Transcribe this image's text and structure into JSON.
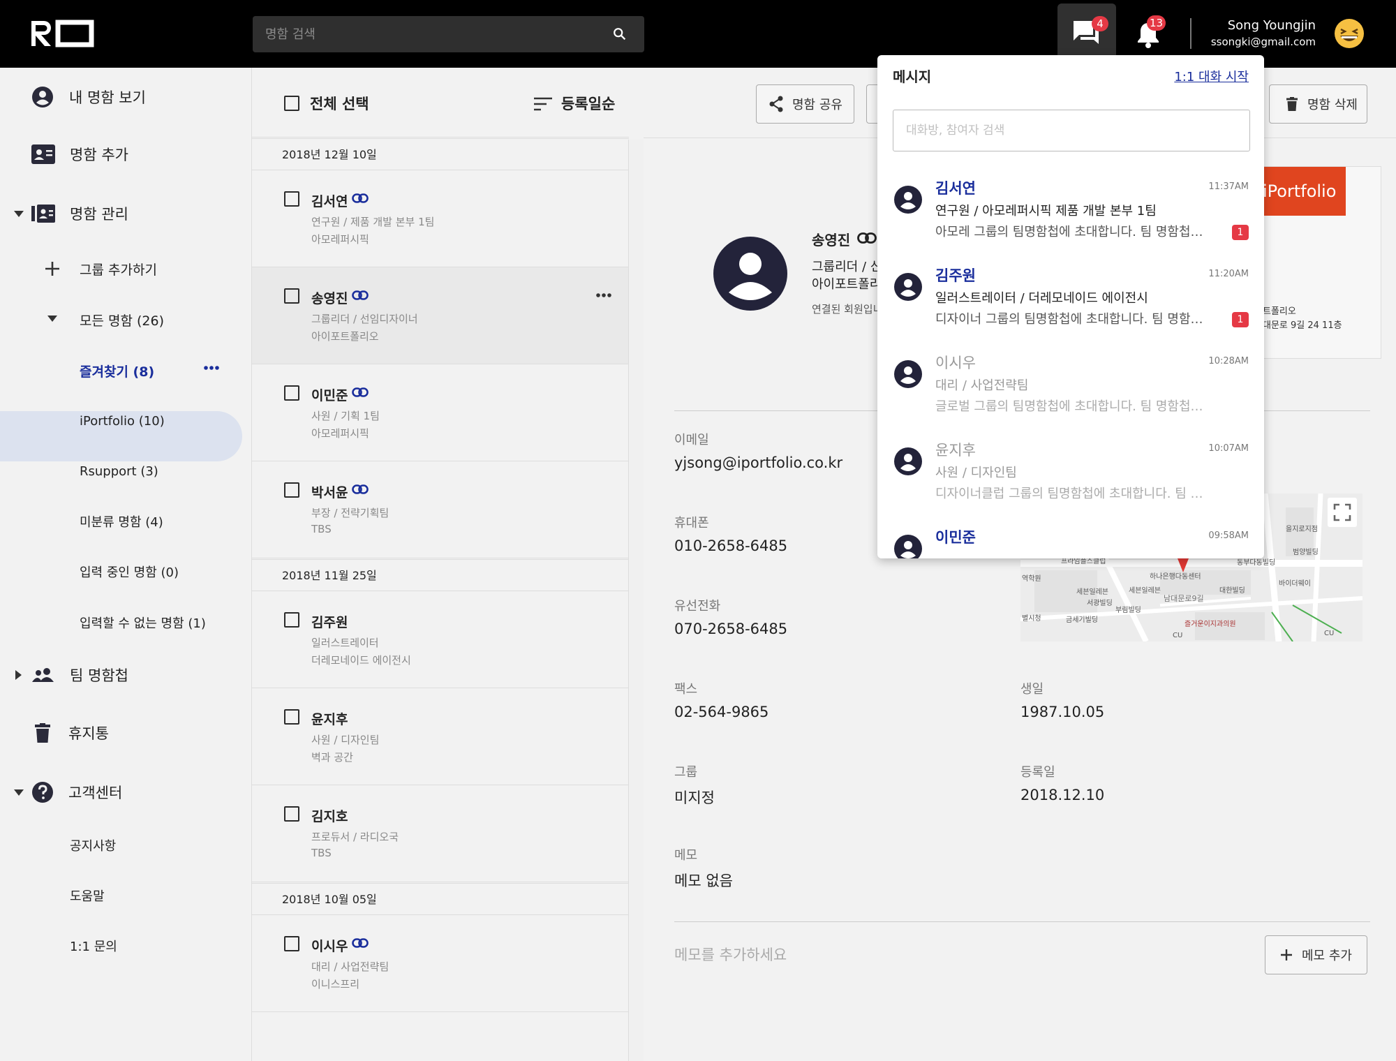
{
  "header": {
    "logo_text": "RO",
    "search_placeholder": "명함 검색",
    "messages_badge": "4",
    "notifications_badge": "13",
    "user_name": "Song Youngjin",
    "user_email": "ssongki@gmail.com"
  },
  "sidebar": {
    "my_card": "내 명함 보기",
    "add_card": "명함 추가",
    "manage": "명함 관리",
    "add_group": "그룹 추가하기",
    "all_cards": "모든 명함 (26)",
    "favorites": "즐겨찾기 (8)",
    "groups": [
      "iPortfolio (10)",
      "Rsupport (3)",
      "미분류 명함 (4)",
      "입력 중인 명함 (0)",
      "입력할 수 없는 명함 (1)"
    ],
    "team": "팀 명함첩",
    "trash": "휴지통",
    "support": "고객센터",
    "support_items": [
      "공지사항",
      "도움말",
      "1:1 문의"
    ]
  },
  "list": {
    "select_all": "전체 선택",
    "sort": "등록일순",
    "dates": [
      "2018년 12월 10일",
      "2018년 11월 25일",
      "2018년 10월 05일"
    ],
    "cards": [
      {
        "name": "김서연",
        "line1": "연구원 / 제품 개발 본부  1팀",
        "line2": "아모레퍼시픽"
      },
      {
        "name": "송영진",
        "line1": "그룹리더 / 선임디자이너",
        "line2": "아이포트폴리오"
      },
      {
        "name": "이민준",
        "line1": "사원 / 기획 1팀",
        "line2": "아모레퍼시픽"
      },
      {
        "name": "박서윤",
        "line1": "부장 / 전략기획팀",
        "line2": "TBS"
      },
      {
        "name": "김주원",
        "line1": "일러스트레이터",
        "line2": "더레모네이드 에이전시"
      },
      {
        "name": "윤지후",
        "line1": "사원 / 디자인팀",
        "line2": "벽과 공간"
      },
      {
        "name": "김지호",
        "line1": "프로듀서 / 라디오국",
        "line2": "TBS"
      },
      {
        "name": "이시우",
        "line1": "대리 / 사업전략팀",
        "line2": "이니스프리"
      }
    ]
  },
  "detail": {
    "share": "명함 공유",
    "delete": "명함 삭제",
    "name": "송영진",
    "role_partial": "그룹리더 / 신",
    "company_partial": "아이포트폴리",
    "connected_partial": "연결된 회원입니",
    "card_brand": "iPortfolio",
    "card_text1": "트폴리오",
    "card_text2": "대문로 9길 24 11층",
    "email_label": "이메일",
    "email": "yjsong@iportfolio.co.kr",
    "mobile_label": "휴대폰",
    "mobile": "010-2658-6485",
    "phone_label": "유선전화",
    "phone": "070-2658-6485",
    "fax_label": "팩스",
    "fax": "02-564-9865",
    "birthday_label": "생일",
    "birthday": "1987.10.05",
    "group_label": "그룹",
    "group": "미지정",
    "registered_label": "등록일",
    "registered": "2018.12.10",
    "memo_label": "메모",
    "memo": "메모 없음",
    "memo_placeholder": "메모를 추가하세요",
    "add_memo": "메모 추가"
  },
  "map_labels": [
    "프라임플스클럽",
    "하나은행다동센터",
    "동부다동빌딩",
    "역학원",
    "세븐일레븐",
    "세븐일레븐",
    "대한빌딩",
    "서광빌딩",
    "부림빌딩",
    "남대문로9길",
    "별시청",
    "금세기빌딩",
    "즐거운이지과의원",
    "을지로지점",
    "범양빌딩",
    "바이더웨이",
    "CU",
    "CU"
  ],
  "messages": {
    "title": "메시지",
    "start_chat": "1:1 대화 시작",
    "search_placeholder": "대화방, 참여자 검색",
    "items": [
      {
        "name": "김서연",
        "time": "11:37AM",
        "line1": "연구원 / 아모레퍼시픽 제품 개발 본부 1팀",
        "line2": "아모레 그룹의 팀명함첩에 초대합니다. 팀 명함첩에서 만나요",
        "badge": "1"
      },
      {
        "name": "김주원",
        "time": "11:20AM",
        "line1": "일러스트레이터 / 더레모네이드 에이전시",
        "line2": "디자이너 그룹의 팀명함첩에 초대합니다. 팀 명함첩에서 만나요",
        "badge": "1"
      },
      {
        "name": "이시우",
        "time": "10:28AM",
        "line1": "대리 / 사업전략팀",
        "line2": "글로벌 그룹의 팀명함첩에 초대합니다. 팀 명함첩에서 만나요"
      },
      {
        "name": "윤지후",
        "time": "10:07AM",
        "line1": "사원 / 디자인팀",
        "line2": "디자이너클럽 그룹의 팀명함첩에 초대합니다. 팀 명함첩"
      },
      {
        "name": "이민준",
        "time": "09:58AM"
      }
    ]
  }
}
